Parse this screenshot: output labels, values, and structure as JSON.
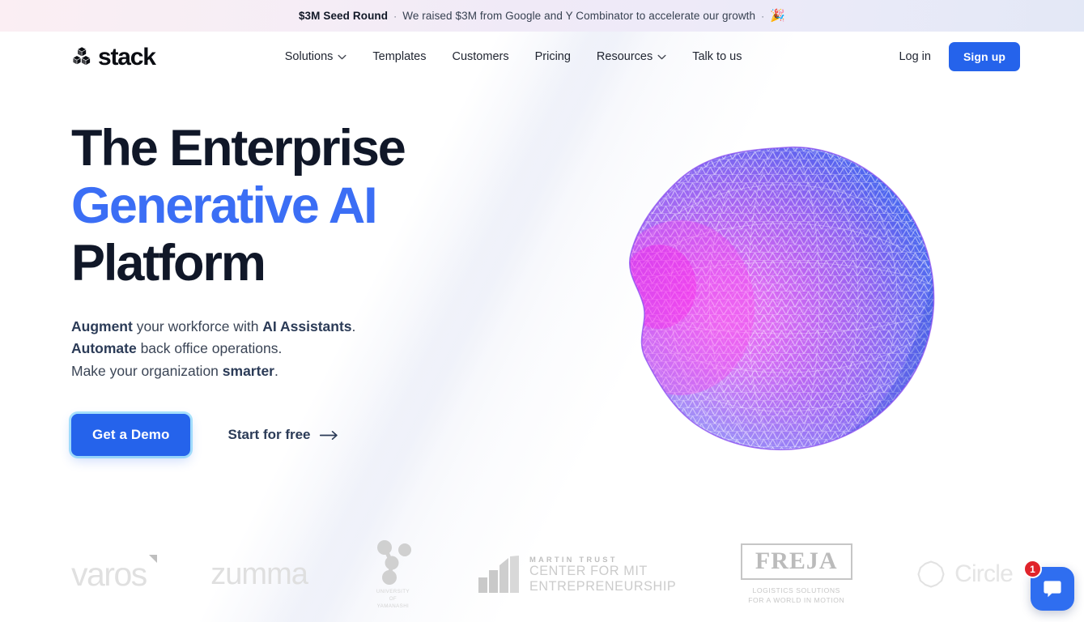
{
  "banner": {
    "lead": "$3M Seed Round",
    "sep1": "·",
    "message": "We raised $3M from Google and Y Combinator to accelerate our growth",
    "sep2": "·",
    "emoji": "🎉",
    "emoji_name": "party-popper-emoji"
  },
  "nav": {
    "logo_text": "stack",
    "logo_mark_name": "stacked-cubes-icon",
    "links": [
      {
        "label": "Solutions",
        "has_chevron": true
      },
      {
        "label": "Templates",
        "has_chevron": false
      },
      {
        "label": "Customers",
        "has_chevron": false
      },
      {
        "label": "Pricing",
        "has_chevron": false
      },
      {
        "label": "Resources",
        "has_chevron": true
      },
      {
        "label": "Talk to us",
        "has_chevron": false
      }
    ],
    "login_label": "Log in",
    "signup_label": "Sign up"
  },
  "hero": {
    "headline_line1": "The Enterprise",
    "headline_line2": "Generative AI",
    "headline_line3": "Platform",
    "sub_line1_bold": "Augment",
    "sub_line1_mid": " your workforce with ",
    "sub_line1_bold2": "AI Assistants",
    "sub_line1_end": ".",
    "sub_line2_bold": "Automate",
    "sub_line2_rest": " back office operations.",
    "sub_line3_start": "Make your organization ",
    "sub_line3_bold": "smarter",
    "sub_line3_end": ".",
    "primary_cta": "Get a Demo",
    "secondary_cta": "Start for free",
    "arrow_icon_name": "arrow-right-icon",
    "blob_name": "generative-ai-mesh-blob-graphic"
  },
  "clients": [
    {
      "name": "varos",
      "text": "varos"
    },
    {
      "name": "zumma",
      "text": "zumma"
    },
    {
      "name": "university-of-yamanashi",
      "line1": "UNIVERSITY",
      "line2": "OF",
      "line3": "YAMANASHI"
    },
    {
      "name": "mit-martin-trust-center",
      "top": "MARTIN TRUST",
      "main1": "CENTER FOR MIT",
      "main2": "ENTREPRENEURSHIP"
    },
    {
      "name": "freja",
      "word": "FREJA",
      "sub1": "LOGISTICS SOLUTIONS",
      "sub2": "FOR A WORLD IN MOTION"
    },
    {
      "name": "circle",
      "text": "Circle"
    }
  ],
  "chat": {
    "badge_count": "1",
    "icon_name": "chat-bubble-icon"
  },
  "colors": {
    "brand_blue": "#2563eb",
    "headline_accent": "#3b6ef5",
    "headline_dark": "#101728",
    "badge_red": "#e0242b"
  }
}
